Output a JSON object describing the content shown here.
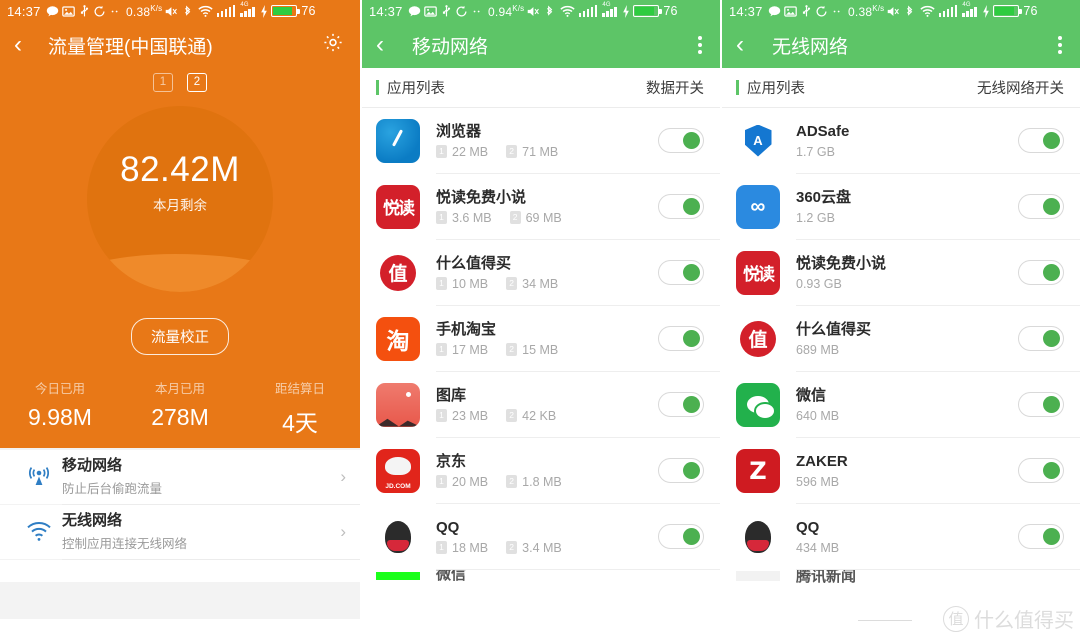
{
  "statusbar": {
    "time": "14:37",
    "battery_percent": "76",
    "icons": [
      "message-icon",
      "photo-icon",
      "usb-icon",
      "sync-icon",
      "more-icon",
      "mute-icon",
      "bluetooth-icon",
      "wifi-icon",
      "signal-icon",
      "signal-4g-icon",
      "charging-icon",
      "battery-icon"
    ],
    "rates": {
      "left": "0.38",
      "mid": "0.94",
      "right": "0.38"
    },
    "rate_unit": "K/s",
    "network_label": "4G"
  },
  "left_panel": {
    "accent_color": "#e87817",
    "title": "流量管理(中国联通)",
    "back_icon": "back-arrow-icon",
    "settings_icon": "gear-icon",
    "sim_tabs": [
      {
        "label": "1",
        "active": false
      },
      {
        "label": "2",
        "active": true
      }
    ],
    "bubble": {
      "value": "82.42M",
      "caption": "本月剩余"
    },
    "calibrate_button": "流量校正",
    "stats": [
      {
        "label": "今日已用",
        "value": "9.98M"
      },
      {
        "label": "本月已用",
        "value": "278M"
      },
      {
        "label": "距结算日",
        "value": "4天"
      }
    ],
    "network_items": [
      {
        "icon": "cell-tower-icon",
        "title": "移动网络",
        "subtitle": "防止后台偷跑流量",
        "chevron": "›"
      },
      {
        "icon": "wifi-icon",
        "title": "无线网络",
        "subtitle": "控制应用连接无线网络",
        "chevron": "›"
      }
    ]
  },
  "mid_panel": {
    "accent_color": "#5dc567",
    "title": "移动网络",
    "back_icon": "back-arrow-icon",
    "menu_icon": "overflow-menu-icon",
    "list_header": {
      "left": "应用列表",
      "right": "数据开关"
    },
    "sim_badges": {
      "sim1": "1",
      "sim2": "2"
    },
    "apps": [
      {
        "name": "浏览器",
        "icon": "browser-app-icon",
        "icon_class": "ic-browser",
        "sim1": "22 MB",
        "sim2": "71 MB",
        "toggle": "on"
      },
      {
        "name": "悦读免费小说",
        "icon": "yuedu-app-icon",
        "icon_class": "ic-yuedu",
        "icon_text": "悦读",
        "sim1": "3.6 MB",
        "sim2": "69 MB",
        "toggle": "on"
      },
      {
        "name": "什么值得买",
        "icon": "smzdm-app-icon",
        "icon_class": "ic-zhi",
        "icon_text": "值",
        "sim1": "10 MB",
        "sim2": "34 MB",
        "toggle": "on"
      },
      {
        "name": "手机淘宝",
        "icon": "taobao-app-icon",
        "icon_class": "ic-taobao",
        "icon_text": "淘",
        "sim1": "17 MB",
        "sim2": "15 MB",
        "toggle": "on"
      },
      {
        "name": "图库",
        "icon": "gallery-app-icon",
        "icon_class": "ic-gallery",
        "sim1": "23 MB",
        "sim2": "42 KB",
        "toggle": "on"
      },
      {
        "name": "京东",
        "icon": "jd-app-icon",
        "icon_class": "ic-jd",
        "icon_text": "JD.COM",
        "sim1": "20 MB",
        "sim2": "1.8 MB",
        "toggle": "on"
      },
      {
        "name": "QQ",
        "icon": "qq-app-icon",
        "icon_class": "ic-qq",
        "sim1": "18 MB",
        "sim2": "3.4 MB",
        "toggle": "on"
      },
      {
        "name": "微信",
        "icon": "wechat-app-icon",
        "icon_class": "ic-plain-green",
        "sim1": "",
        "sim2": "",
        "toggle": "on"
      }
    ]
  },
  "right_panel": {
    "accent_color": "#5dc567",
    "title": "无线网络",
    "back_icon": "back-arrow-icon",
    "menu_icon": "overflow-menu-icon",
    "list_header": {
      "left": "应用列表",
      "right": "无线网络开关"
    },
    "apps": [
      {
        "name": "ADSafe",
        "icon": "adsafe-app-icon",
        "icon_class": "ic-adsafe",
        "icon_text": "A",
        "usage": "1.7 GB",
        "toggle": "on"
      },
      {
        "name": "360云盘",
        "icon": "360cloud-app-icon",
        "icon_class": "ic-360",
        "icon_text": "∞",
        "usage": "1.2 GB",
        "toggle": "on"
      },
      {
        "name": "悦读免费小说",
        "icon": "yuedu-app-icon",
        "icon_class": "ic-yuedu",
        "icon_text": "悦读",
        "usage": "0.93 GB",
        "toggle": "on"
      },
      {
        "name": "什么值得买",
        "icon": "smzdm-app-icon",
        "icon_class": "ic-zhi",
        "icon_text": "值",
        "usage": "689 MB",
        "toggle": "on"
      },
      {
        "name": "微信",
        "icon": "wechat-app-icon",
        "icon_class": "ic-wechat",
        "usage": "640 MB",
        "toggle": "on"
      },
      {
        "name": "ZAKER",
        "icon": "zaker-app-icon",
        "icon_class": "ic-zaker",
        "icon_text": "Z",
        "usage": "596 MB",
        "toggle": "on"
      },
      {
        "name": "QQ",
        "icon": "qq-app-icon",
        "icon_class": "ic-qq",
        "usage": "434 MB",
        "toggle": "on"
      },
      {
        "name": "腾讯新闻",
        "icon": "tencentnews-app-icon",
        "icon_class": "ic-tencentnews",
        "usage": "",
        "toggle": "on"
      }
    ],
    "watermark": {
      "mark": "值",
      "text": "什么值得买"
    }
  }
}
